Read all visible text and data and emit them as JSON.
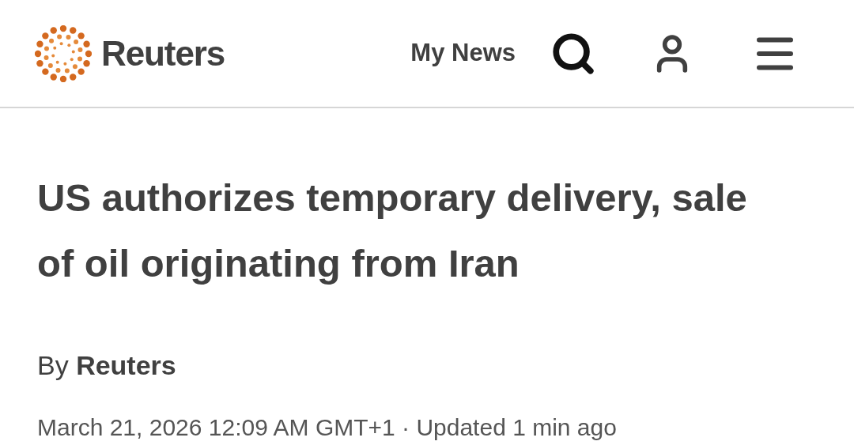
{
  "header": {
    "brand": "Reuters",
    "my_news": "My News"
  },
  "article": {
    "headline": "US authorizes temporary delivery, sale of oil originating from Iran",
    "byline": "By **Reuters**",
    "dateline": "March 21, 2026 12:09 AM GMT+1 · Updated 1 min ago"
  }
}
